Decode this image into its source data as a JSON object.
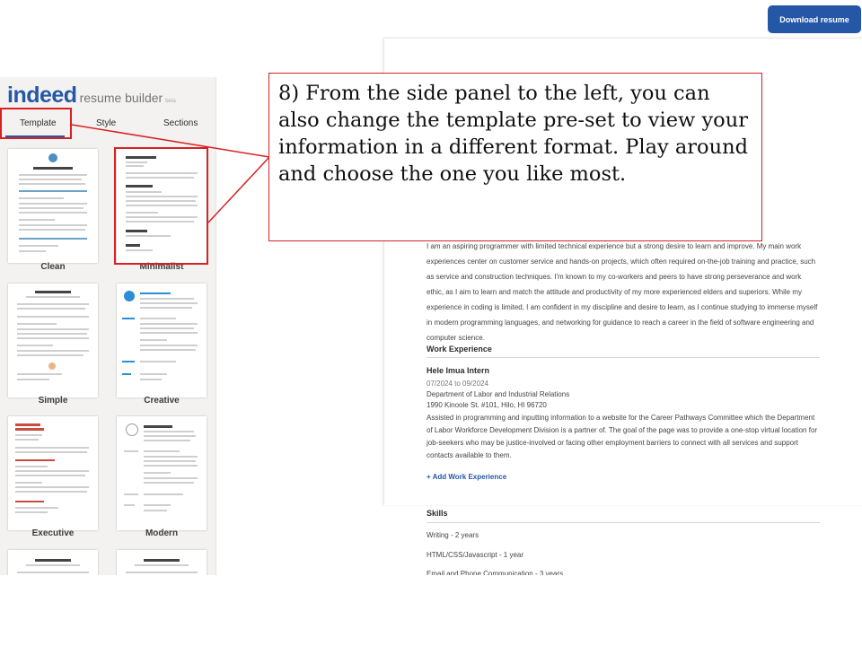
{
  "logo": {
    "brand": "indeed",
    "product": "resume builder",
    "badge": "beta"
  },
  "tabs": [
    {
      "label": "Template"
    },
    {
      "label": "Style"
    },
    {
      "label": "Sections"
    }
  ],
  "templates": [
    {
      "label": "Clean"
    },
    {
      "label": "Minimalist"
    },
    {
      "label": "Simple"
    },
    {
      "label": "Creative"
    },
    {
      "label": "Executive"
    },
    {
      "label": "Modern"
    }
  ],
  "download_button": {
    "label": "Download resume"
  },
  "resume": {
    "summary_lines": [
      "I am an aspiring programmer with limited technical experience but a strong desire to learn and improve. My main work",
      "experiences center on customer service and hands-on projects, which often required on-the-job training and practice, such",
      "as service and construction techniques. I'm known to my co-workers and peers to have strong perseverance and work",
      "ethic, as I aim to learn and match the attitude and productivity of my more experienced elders and superiors. While my",
      "experience in coding is limited, I am confident in my discipline and desire to learn, as I continue studying to immerse myself",
      "in modern programming languages, and networking for guidance to reach a career in the field of software engineering and",
      "computer science."
    ],
    "work": {
      "heading": "Work Experience",
      "job_title": "Hele Imua Intern",
      "dates": "07/2024  to  09/2024",
      "employer": "Department of Labor and Industrial Relations",
      "address": "1990 Kinoole St. #101, Hilo, HI 96720",
      "description_lines": [
        "Assisted in programming and inputting information to a website for the Career Pathways Committee which the Department",
        "of Labor Workforce Development Division is a partner of. The goal of the page was to provide a one-stop virtual location for",
        "job-seekers who may be justice-involved or facing other employment barriers to connect with all services and support",
        "contacts available to them."
      ],
      "add_link": "+ Add Work Experience"
    },
    "skills": {
      "heading": "Skills",
      "items": [
        "Writing  -  2 years",
        "HTML/CSS/Javascript  -  1 year",
        "Email and Phone Communication  -  3 years"
      ]
    }
  },
  "callout": {
    "text": "8) From the side panel to the left, you can also change the template pre-set to view your information in a different format. Play around and choose the one you like most."
  },
  "colors": {
    "accent": "#2557a7",
    "annotation": "#d62222"
  }
}
